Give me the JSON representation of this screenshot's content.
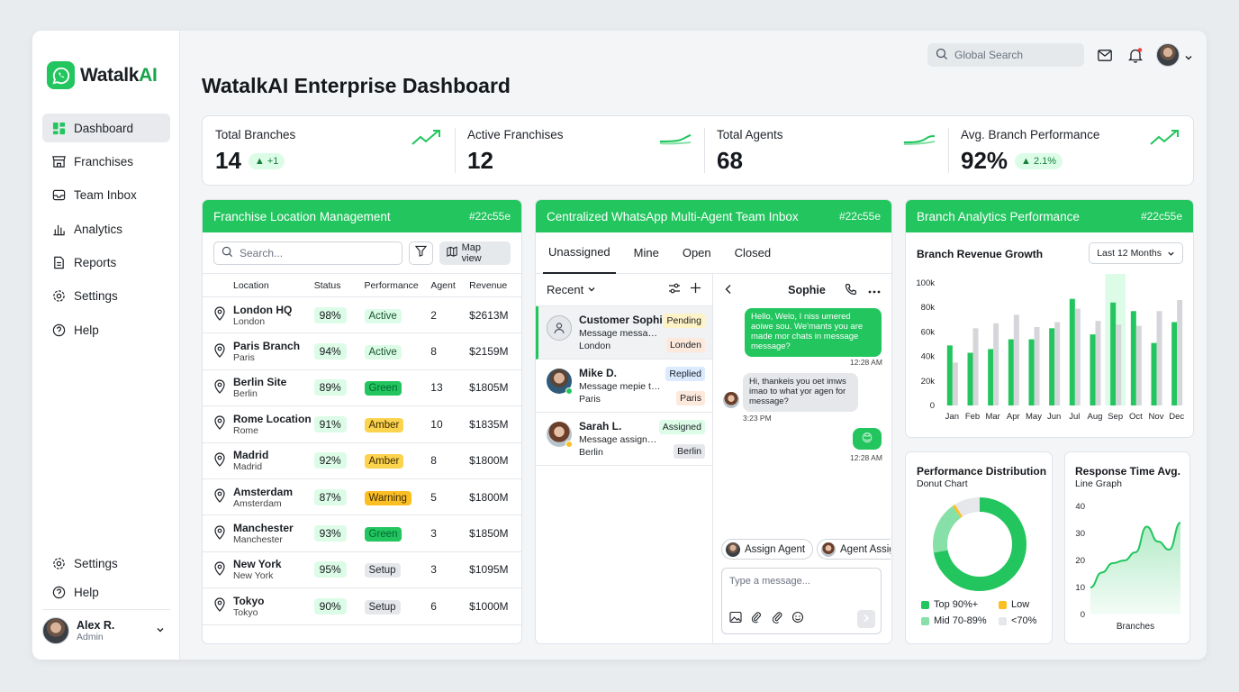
{
  "brand": {
    "name_main": "Watalk",
    "name_ai": "AI"
  },
  "sidebar": {
    "items": [
      {
        "label": "Dashboard"
      },
      {
        "label": "Franchises"
      },
      {
        "label": "Team Inbox"
      },
      {
        "label": "Analytics"
      },
      {
        "label": "Reports"
      },
      {
        "label": "Settings"
      },
      {
        "label": "Help"
      }
    ],
    "bottom": [
      {
        "label": "Settings"
      },
      {
        "label": "Help"
      }
    ],
    "user": {
      "name": "Alex R.",
      "role": "Admin"
    }
  },
  "header": {
    "search_placeholder": "Global Search",
    "title": "WatalkAI Enterprise Dashboard"
  },
  "kpis": [
    {
      "label": "Total Branches",
      "value": "14",
      "delta": "+1"
    },
    {
      "label": "Active Franchises",
      "value": "12",
      "delta": ""
    },
    {
      "label": "Total Agents",
      "value": "68",
      "delta": ""
    },
    {
      "label": "Avg. Branch Performance",
      "value": "92%",
      "delta": "2.1%"
    }
  ],
  "franchise": {
    "title": "Franchise Location Management",
    "tag": "#22c55e",
    "search_placeholder": "Search...",
    "map_label": "Map view",
    "columns": [
      "Location",
      "Status",
      "Performance",
      "Agent",
      "Revenue"
    ],
    "rows": [
      {
        "name": "London HQ",
        "city": "London",
        "status": "98%",
        "perf": "Active",
        "agent": "2",
        "revenue": "$2613M"
      },
      {
        "name": "Paris Branch",
        "city": "Paris",
        "status": "94%",
        "perf": "Active",
        "agent": "8",
        "revenue": "$2159M"
      },
      {
        "name": "Berlin Site",
        "city": "Berlin",
        "status": "89%",
        "perf": "Green",
        "agent": "13",
        "revenue": "$1805M"
      },
      {
        "name": "Rome Location",
        "city": "Rome",
        "status": "91%",
        "perf": "Amber",
        "agent": "10",
        "revenue": "$1835M"
      },
      {
        "name": "Madrid",
        "city": "Madrid",
        "status": "92%",
        "perf": "Amber",
        "agent": "8",
        "revenue": "$1800M"
      },
      {
        "name": "Amsterdam",
        "city": "Amsterdam",
        "status": "87%",
        "perf": "Warning",
        "agent": "5",
        "revenue": "$1800M"
      },
      {
        "name": "Manchester",
        "city": "Manchester",
        "status": "93%",
        "perf": "Green",
        "agent": "3",
        "revenue": "$1850M"
      },
      {
        "name": "New York",
        "city": "New York",
        "status": "95%",
        "perf": "Setup",
        "agent": "3",
        "revenue": "$1095M"
      },
      {
        "name": "Tokyo",
        "city": "Tokyo",
        "status": "90%",
        "perf": "Setup",
        "agent": "6",
        "revenue": "$1000M"
      }
    ]
  },
  "inbox": {
    "title": "Centralized WhatsApp Multi-Agent Team Inbox",
    "tag": "#22c55e",
    "tabs": [
      "Unassigned",
      "Mine",
      "Open",
      "Closed"
    ],
    "list_label": "Recent",
    "conversations": [
      {
        "name": "Customer Sophie",
        "msg": "Message messagr...",
        "city": "London",
        "badge": "Pending",
        "loc": "Londen"
      },
      {
        "name": "Mike D.",
        "msg": "Message mepie t/a...",
        "city": "Paris",
        "badge": "Replied",
        "loc": "Paris"
      },
      {
        "name": "Sarah L.",
        "msg": "Message assignet...",
        "city": "Berlin",
        "badge": "Assigned",
        "loc": "Berlin"
      }
    ],
    "chat": {
      "name": "Sophie",
      "msg1": "Hello, Welo, I niss umered aoiwe sou. We'mants you are made mor chats in message message?",
      "time1": "12:28 AM",
      "msg2": "Hi, thankeis you oet imws imao to what yor agen for message?",
      "time2": "3:23 PM",
      "msg3": "😊",
      "time3": "12:28 AM",
      "assign1": "Assign Agent",
      "assign2": "Agent Assign",
      "placeholder": "Type a message..."
    }
  },
  "analytics": {
    "title": "Branch Analytics Performance",
    "tag": "#22c55e",
    "revenue_title": "Branch Revenue Growth",
    "range": "Last 12 Months",
    "dist_title": "Performance Distribution",
    "dist_sub": "Donut Chart",
    "dist_legend": [
      "Top 90%+",
      "Low",
      "Mid 70-89%",
      "<70%"
    ],
    "resp_title": "Response Time Avg.",
    "resp_sub": "Line Graph",
    "resp_xlabel": "Branches"
  },
  "chart_data": [
    {
      "type": "bar",
      "title": "Branch Revenue Growth",
      "categories": [
        "Jan",
        "Feb",
        "Mar",
        "Apr",
        "May",
        "Jun",
        "Jul",
        "Aug",
        "Sep",
        "Oct",
        "Nov",
        "Dec"
      ],
      "yticks": [
        "0",
        "20k",
        "40k",
        "60k",
        "80k",
        "100k"
      ],
      "ylim": [
        0,
        100000
      ],
      "highlight": "Sep",
      "colors": {
        "a": "#22c55e",
        "b": "#d4d6d9"
      },
      "series": [
        {
          "values": [
            49000,
            43000,
            46000,
            54000,
            54000,
            63000,
            87000,
            58000,
            84000,
            77000,
            51000,
            68000
          ]
        },
        {
          "values": [
            35000,
            63000,
            67000,
            74000,
            64000,
            68000,
            79000,
            69000,
            66000,
            65000,
            77000,
            86000
          ]
        }
      ]
    },
    {
      "type": "pie",
      "title": "Performance Distribution",
      "categories": [
        "Top 90%+",
        "Mid 70-89%",
        "Low",
        "<70%"
      ],
      "values": [
        72,
        18,
        1,
        9
      ],
      "colors": [
        "#22c55e",
        "#86e0a8",
        "#fbbf24",
        "#e5e7eb"
      ]
    },
    {
      "type": "area",
      "title": "Response Time Avg.",
      "xlabel": "Branches",
      "yticks": [
        "0",
        "10",
        "20",
        "30",
        "40"
      ],
      "ylim": [
        0,
        40
      ],
      "values": [
        10,
        15.5,
        19,
        20,
        23,
        32.5,
        27,
        24,
        34
      ]
    }
  ]
}
